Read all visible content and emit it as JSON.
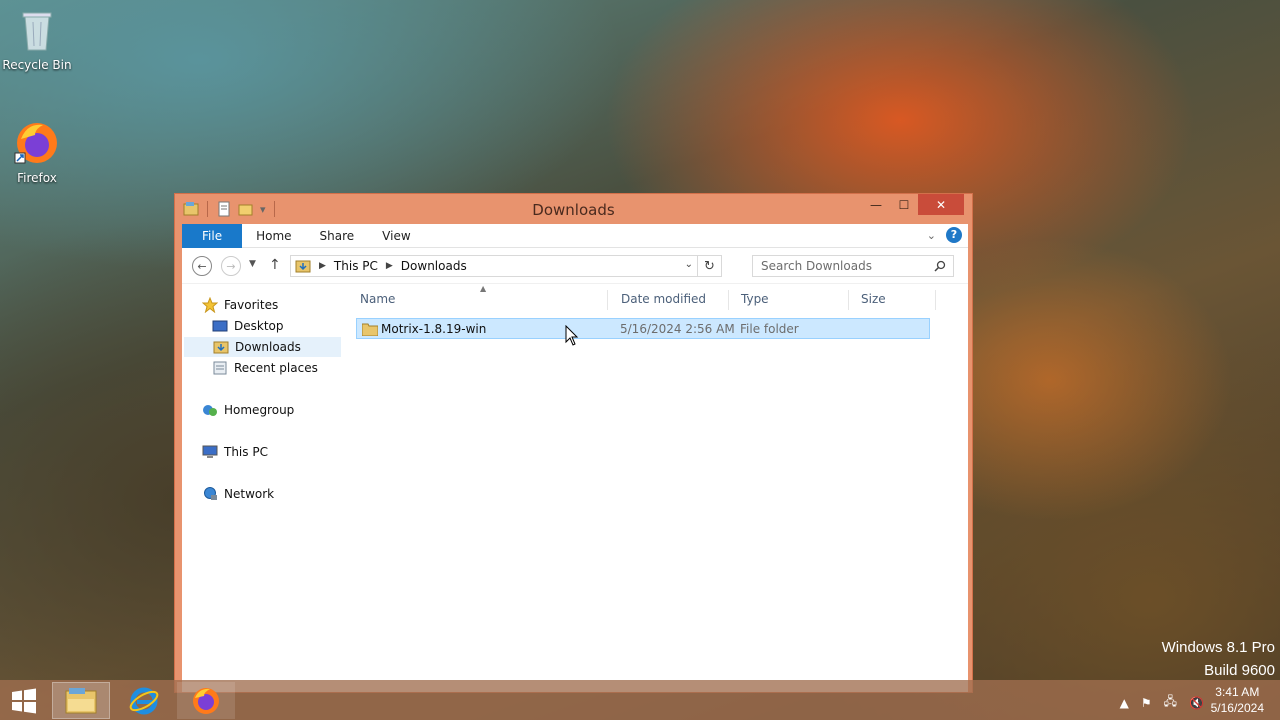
{
  "desktop": {
    "icons": [
      {
        "label": "Recycle Bin"
      },
      {
        "label": "Firefox"
      }
    ],
    "watermark": {
      "line1": "Windows 8.1 Pro",
      "line2": "Build 9600"
    }
  },
  "window": {
    "title": "Downloads",
    "ribbon_tabs": [
      "File",
      "Home",
      "Share",
      "View"
    ],
    "address": {
      "crumbs": [
        "This PC",
        "Downloads"
      ]
    },
    "search": {
      "placeholder": "Search Downloads"
    },
    "nav_pane": {
      "favorites": "Favorites",
      "favorite_items": [
        "Desktop",
        "Downloads",
        "Recent places"
      ],
      "homegroup": "Homegroup",
      "this_pc": "This PC",
      "network": "Network"
    },
    "columns": [
      "Name",
      "Date modified",
      "Type",
      "Size"
    ],
    "files": [
      {
        "name": "Motrix-1.8.19-win",
        "date": "5/16/2024 2:56 AM",
        "type": "File folder",
        "size": ""
      }
    ]
  },
  "taskbar": {
    "clock_time": "3:41 AM",
    "clock_date": "5/16/2024"
  },
  "colors": {
    "window_frame": "#e8936e",
    "close_button": "#c94c3a",
    "file_tab": "#1979ca",
    "selection": "#cce8ff"
  }
}
